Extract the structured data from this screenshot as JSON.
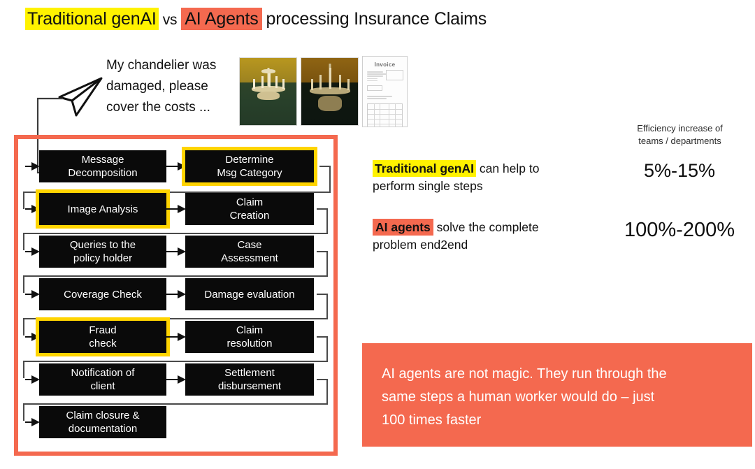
{
  "title": {
    "part1": "Traditional genAI",
    "vs": "vs",
    "part2": "AI Agents",
    "part3": "processing Insurance Claims"
  },
  "message": {
    "line1": "My chandelier was",
    "line2": "damaged,  please",
    "line3": "cover the costs ...",
    "plane_icon": "paper-plane-icon"
  },
  "attachments": [
    {
      "name": "chandelier-photo-1",
      "kind": "photo"
    },
    {
      "name": "chandelier-photo-2",
      "kind": "photo"
    },
    {
      "name": "invoice-document",
      "kind": "document",
      "doc_title": "Invoice"
    }
  ],
  "flow": {
    "frame_color": "#F4694F",
    "highlight_color": "#FFD400",
    "node_color": "#0a0a0a",
    "rows": [
      {
        "left": {
          "line1": "Message",
          "line2": "Decomposition",
          "highlighted": false
        },
        "right": {
          "line1": "Determine",
          "line2": "Msg Category",
          "highlighted": true
        }
      },
      {
        "left": {
          "line1": "Image Analysis",
          "line2": "",
          "highlighted": true
        },
        "right": {
          "line1": "Claim",
          "line2": "Creation",
          "highlighted": false
        }
      },
      {
        "left": {
          "line1": "Queries to the",
          "line2": "policy holder",
          "highlighted": false
        },
        "right": {
          "line1": "Case",
          "line2": "Assessment",
          "highlighted": false
        }
      },
      {
        "left": {
          "line1": "Coverage Check",
          "line2": "",
          "highlighted": false
        },
        "right": {
          "line1": "Damage evaluation",
          "line2": "",
          "highlighted": false
        }
      },
      {
        "left": {
          "line1": "Fraud",
          "line2": "check",
          "highlighted": true
        },
        "right": {
          "line1": "Claim",
          "line2": "resolution",
          "highlighted": false
        }
      },
      {
        "left": {
          "line1": "Notification of",
          "line2": "client",
          "highlighted": false
        },
        "right": {
          "line1": "Settlement",
          "line2": "disbursement",
          "highlighted": false
        }
      },
      {
        "left": {
          "line1": "Claim closure &",
          "line2": "documentation",
          "highlighted": false
        },
        "right": null
      }
    ]
  },
  "efficiency": {
    "heading_line1": "Efficiency increase of",
    "heading_line2": "teams / departments",
    "rows": [
      {
        "badge": "Traditional genAI",
        "badge_style": "yellow",
        "text_line1": "can help to",
        "text_line2": "perform single steps",
        "value": "5%-15%"
      },
      {
        "badge": "AI agents",
        "badge_style": "orange",
        "text_line1": "solve the complete",
        "text_line2": "problem end2end",
        "value": "100%-200%"
      }
    ]
  },
  "callout": {
    "background": "#F4694F",
    "line1": "AI agents are not magic. They run through the",
    "line2": "same steps a human worker would do – just",
    "line3": "100 times faster"
  }
}
